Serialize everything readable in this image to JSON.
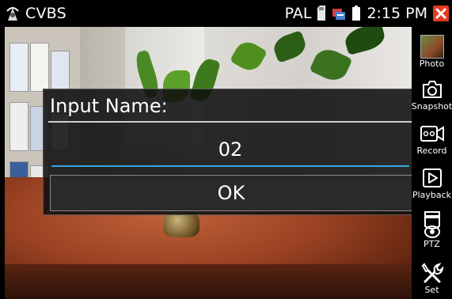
{
  "status_bar": {
    "title": "CVBS",
    "format": "PAL",
    "time": "2:15 PM"
  },
  "dialog": {
    "title": "Input Name:",
    "input_value": "02",
    "ok_label": "OK"
  },
  "sidebar": {
    "items": [
      {
        "label": "Photo",
        "icon": "photo-thumbnail-icon"
      },
      {
        "label": "Snapshot",
        "icon": "camera-icon"
      },
      {
        "label": "Record",
        "icon": "video-camera-icon"
      },
      {
        "label": "Playback",
        "icon": "play-icon"
      },
      {
        "label": "PTZ",
        "icon": "dome-camera-icon"
      },
      {
        "label": "Set",
        "icon": "tools-icon"
      }
    ]
  },
  "colors": {
    "close_button": "#e63a1f",
    "input_underline": "#36a7e0",
    "dialog_bg": "#0f0f0f"
  }
}
